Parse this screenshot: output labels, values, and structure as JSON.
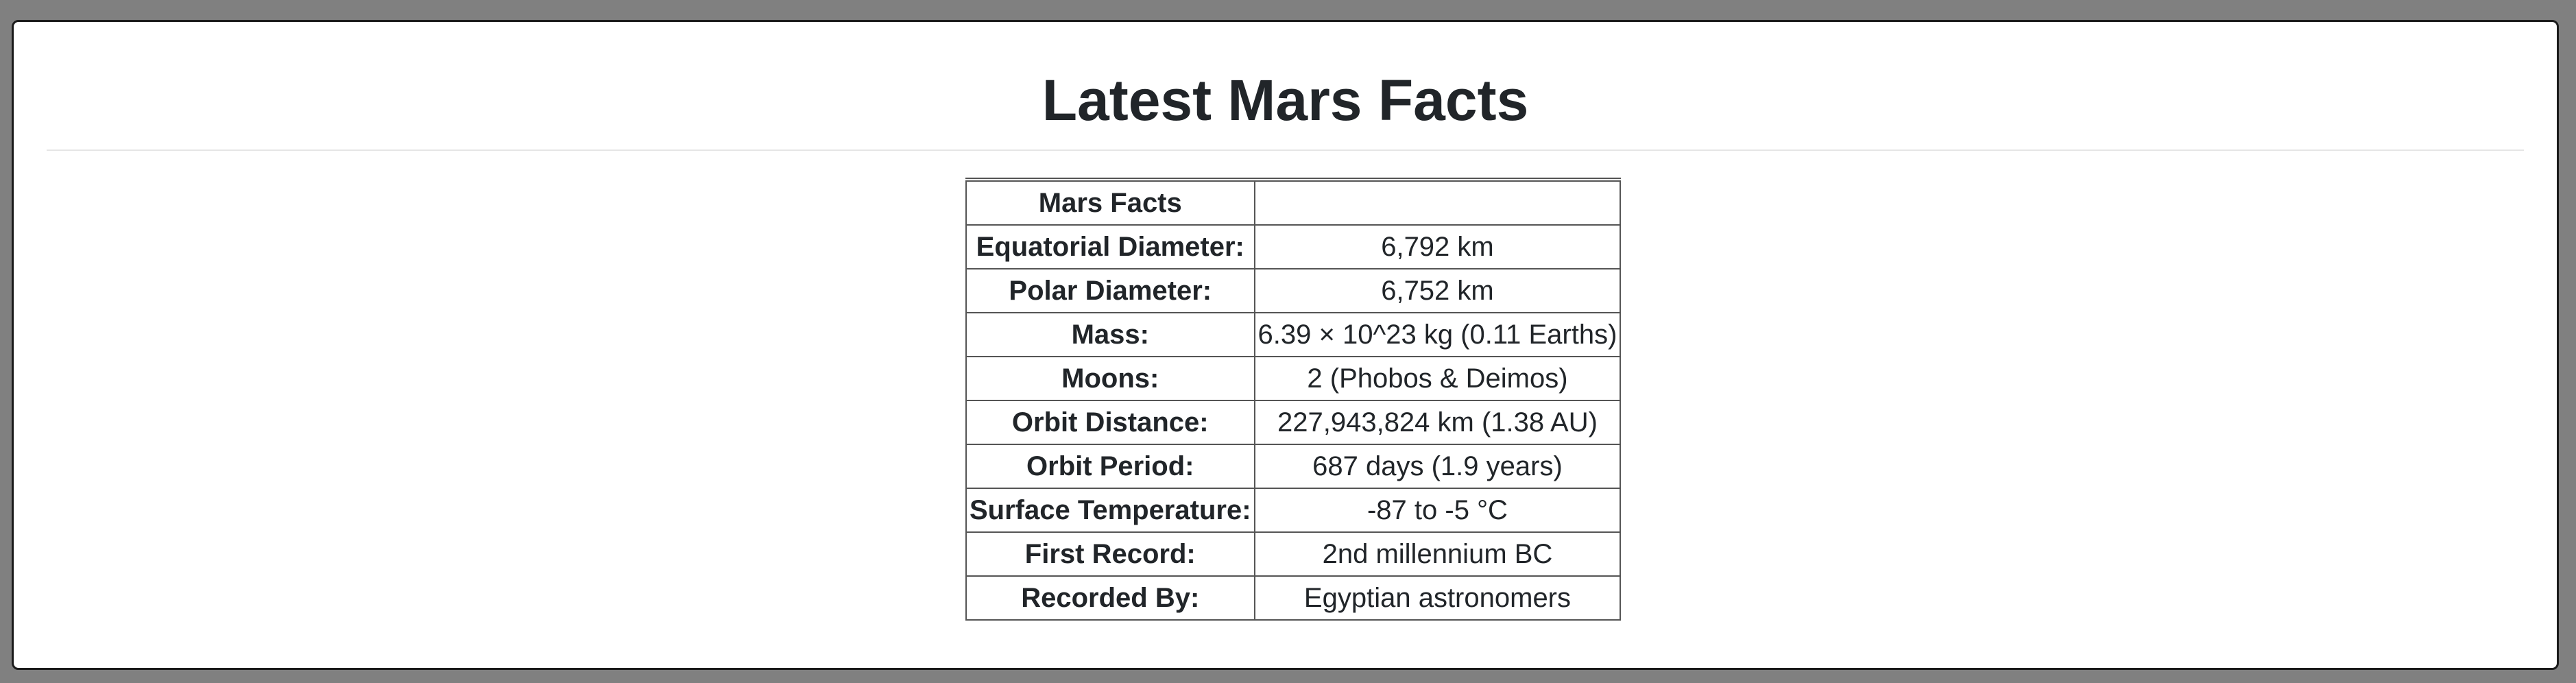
{
  "page": {
    "title": "Latest Mars Facts"
  },
  "table": {
    "header": {
      "label": "Mars Facts",
      "value": ""
    },
    "rows": [
      {
        "label": "Equatorial Diameter:",
        "value": "6,792 km"
      },
      {
        "label": "Polar Diameter:",
        "value": "6,752 km"
      },
      {
        "label": "Mass:",
        "value": "6.39 × 10^23 kg (0.11 Earths)"
      },
      {
        "label": "Moons:",
        "value": "2 (Phobos & Deimos)"
      },
      {
        "label": "Orbit Distance:",
        "value": "227,943,824 km (1.38 AU)"
      },
      {
        "label": "Orbit Period:",
        "value": "687 days (1.9 years)"
      },
      {
        "label": "Surface Temperature:",
        "value": "-87 to -5 °C"
      },
      {
        "label": "First Record:",
        "value": "2nd millennium BC"
      },
      {
        "label": "Recorded By:",
        "value": "Egyptian astronomers"
      }
    ]
  }
}
